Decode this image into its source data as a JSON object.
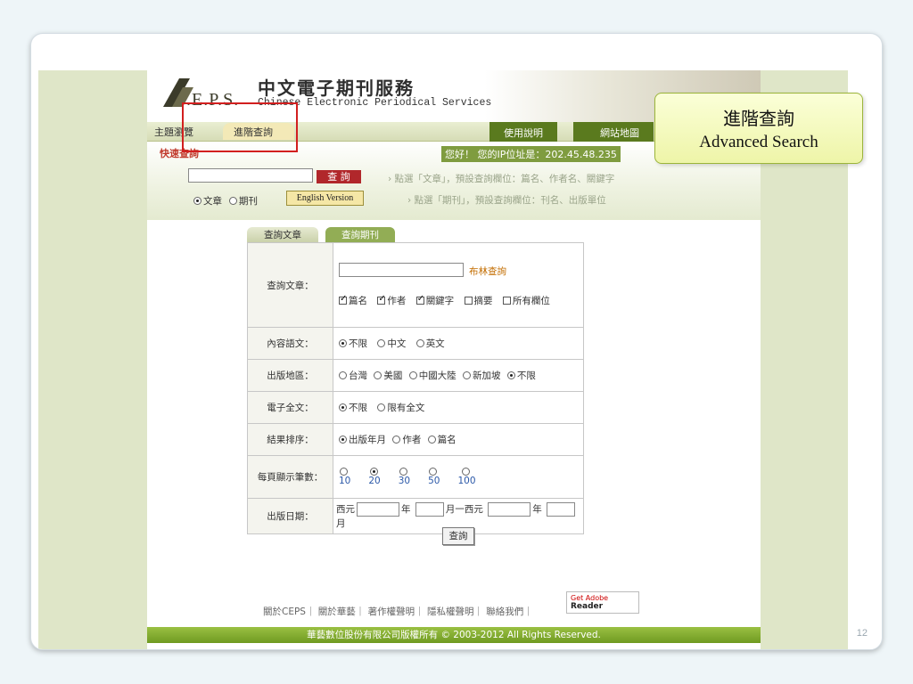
{
  "slide_number": "12",
  "header": {
    "logo_text": ".E.P.S.",
    "title_zh": "中文電子期刊服務",
    "title_en": "Chinese Electronic Periodical Services"
  },
  "nav": {
    "browse": "主題瀏覽",
    "advanced": "進階查詢",
    "help": "使用說明",
    "sitemap": "網站地圖"
  },
  "quick": {
    "label": "快速查詢",
    "ip_text": "您好！ 您的IP位址是：202.45.48.235",
    "search_btn": "查 詢",
    "hint1": "› 點選「文章」，預設查詢欄位：篇名、作者名、關鍵字",
    "hint2": "› 點選「期刊」，預設查詢欄位：刊名、出版單位",
    "radio_article": "文章",
    "radio_journal": "期刊",
    "english_btn": "English Version"
  },
  "tabs": {
    "articles": "查詢文章",
    "journals": "查詢期刊"
  },
  "form": {
    "query_label": "查詢文章：",
    "boolean": "布林查詢",
    "fields": [
      {
        "label": "篇名",
        "checked": true
      },
      {
        "label": "作者",
        "checked": true
      },
      {
        "label": "關鍵字",
        "checked": true
      },
      {
        "label": "摘要",
        "checked": false
      },
      {
        "label": "所有欄位",
        "checked": false
      }
    ],
    "lang_label": "內容語文：",
    "lang_opts": [
      "不限",
      "中文",
      "英文"
    ],
    "region_label": "出版地區：",
    "region_opts": [
      "台灣",
      "美國",
      "中國大陸",
      "新加坡",
      "不限"
    ],
    "fulltext_label": "電子全文：",
    "fulltext_opts": [
      "不限",
      "限有全文"
    ],
    "sort_label": "結果排序：",
    "sort_opts": [
      "出版年月",
      "作者",
      "篇名"
    ],
    "perpage_label": "每頁顯示筆數：",
    "perpage_opts": [
      "10",
      "20",
      "30",
      "50",
      "100"
    ],
    "date_label": "出版日期：",
    "date_western": "西元",
    "date_year": "年",
    "date_month_to": "月一西元",
    "date_month": "月",
    "submit": "查詢"
  },
  "footer": {
    "links": "關於CEPS｜ 關於華藝｜ 著作權聲明｜ 隱私權聲明｜ 聯絡我們｜",
    "adobe_get": "Get Adobe",
    "adobe_reader": "Reader",
    "copyright": "華藝數位股份有限公司版權所有 © 2003-2012 All Rights Reserved."
  },
  "callout": {
    "zh": "進階查詢",
    "en": "Advanced Search"
  },
  "colors": {
    "accent_green": "#7f9c3f",
    "highlight_red": "#d21f1f"
  }
}
